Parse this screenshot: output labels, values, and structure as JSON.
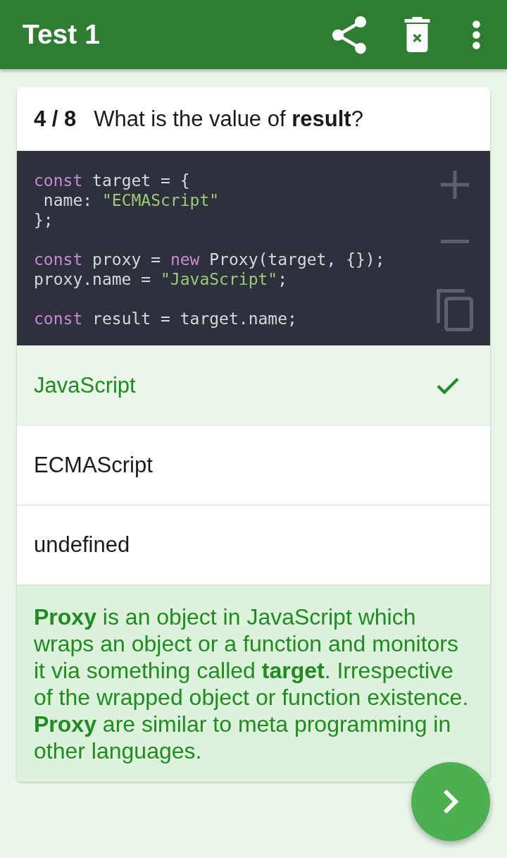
{
  "app_bar": {
    "title": "Test 1"
  },
  "question": {
    "counter": "4 / 8",
    "text": "What is the value of **result**?"
  },
  "code": {
    "blocks": [
      {
        "lines": [
          {
            "tokens": [
              {
                "kind": "keyword",
                "text": "const"
              },
              {
                "kind": "plain",
                "text": " target = {"
              }
            ]
          },
          {
            "tokens": [
              {
                "kind": "plain",
                "text": " name: "
              },
              {
                "kind": "string",
                "text": "\"ECMAScript\""
              }
            ]
          },
          {
            "tokens": [
              {
                "kind": "plain",
                "text": "};"
              }
            ]
          }
        ]
      },
      {
        "lines": [
          {
            "tokens": [
              {
                "kind": "keyword",
                "text": "const"
              },
              {
                "kind": "plain",
                "text": " proxy = "
              },
              {
                "kind": "keyword",
                "text": "new"
              },
              {
                "kind": "plain",
                "text": " Proxy(target, {});"
              }
            ]
          },
          {
            "tokens": [
              {
                "kind": "plain",
                "text": "proxy.name = "
              },
              {
                "kind": "string",
                "text": "\"JavaScript\""
              },
              {
                "kind": "plain",
                "text": ";"
              }
            ]
          }
        ]
      },
      {
        "lines": [
          {
            "tokens": [
              {
                "kind": "keyword",
                "text": "const"
              },
              {
                "kind": "plain",
                "text": " result = target.name;"
              }
            ]
          }
        ]
      }
    ]
  },
  "options": [
    {
      "label": "JavaScript",
      "selected": true
    },
    {
      "label": "ECMAScript",
      "selected": false
    },
    {
      "label": "undefined",
      "selected": false
    }
  ],
  "explanation": {
    "text": "**Proxy** is an object in JavaScript which wraps an object or a function and monitors it via something called **target**. Irrespective of the wrapped object or function existence. **Proxy** are similar to meta programming in other languages."
  }
}
